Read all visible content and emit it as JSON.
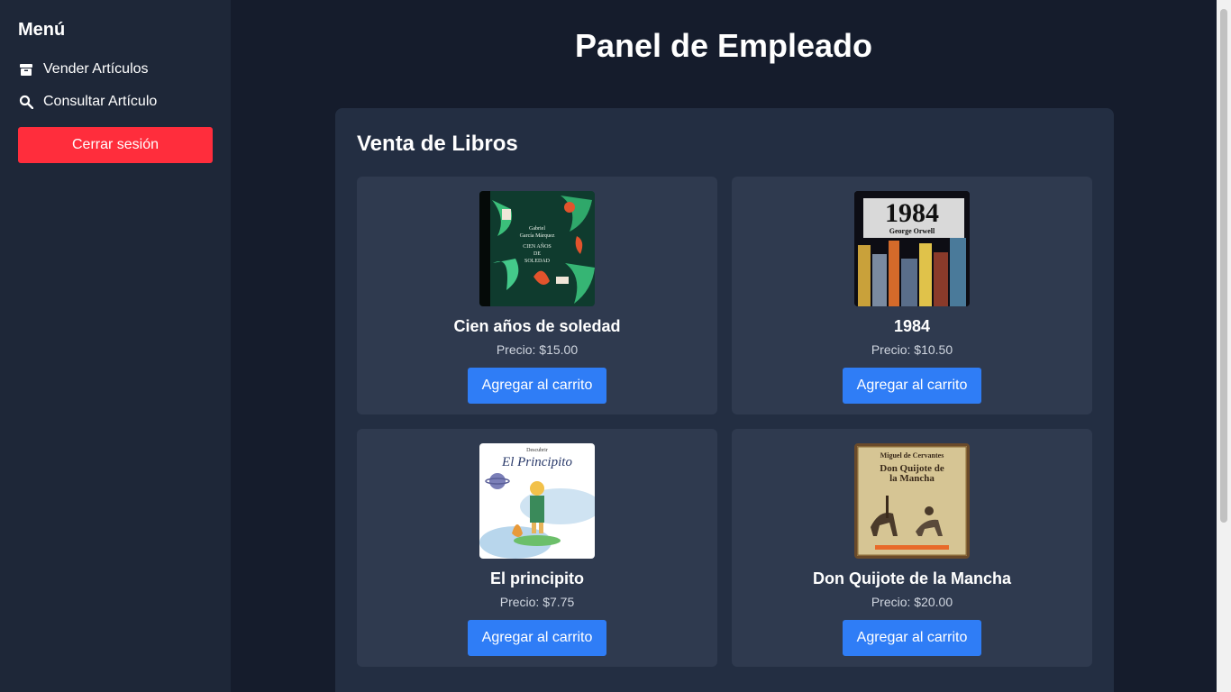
{
  "sidebar": {
    "title": "Menú",
    "items": [
      {
        "label": "Vender Artículos",
        "icon": "box-icon"
      },
      {
        "label": "Consultar Artículo",
        "icon": "search-icon"
      }
    ],
    "logout_label": "Cerrar sesión"
  },
  "main": {
    "title": "Panel de Empleado",
    "section_title": "Venta de Libros",
    "books": [
      {
        "title": "Cien años de soledad",
        "price": "Precio: $15.00",
        "button": "Agregar al carrito",
        "cover_lines": [
          "Gabriel",
          "García Márquez",
          "CIEN AÑOS",
          "DE",
          "SOLEDAD"
        ]
      },
      {
        "title": "1984",
        "price": "Precio: $10.50",
        "button": "Agregar al carrito",
        "cover_lines": [
          "1984",
          "George Orwell"
        ]
      },
      {
        "title": "El principito",
        "price": "Precio: $7.75",
        "button": "Agregar al carrito",
        "cover_lines": [
          "Descubrir",
          "El Principito"
        ]
      },
      {
        "title": "Don Quijote de la Mancha",
        "price": "Precio: $20.00",
        "button": "Agregar al carrito",
        "cover_lines": [
          "Miguel de Cervantes",
          "Don Quijote de",
          "la Mancha"
        ]
      }
    ]
  },
  "colors": {
    "background": "#151c2c",
    "sidebar": "#1e2738",
    "panel": "#232e42",
    "card": "#2f3a4f",
    "logout": "#ff2d3c",
    "accent": "#2f7df6"
  }
}
